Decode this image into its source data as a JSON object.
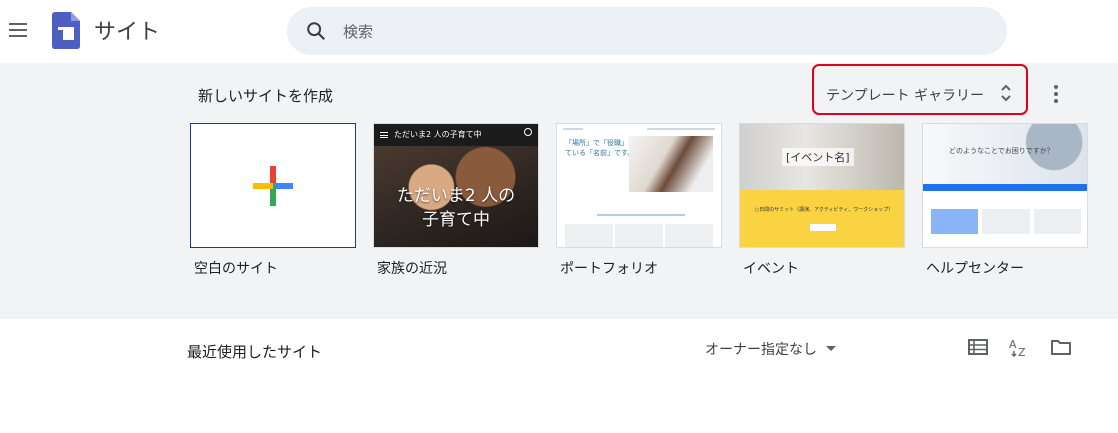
{
  "header": {
    "app_title": "サイト",
    "search_placeholder": "検索",
    "brand_color": "#4285f4"
  },
  "templates": {
    "section_title": "新しいサイトを作成",
    "gallery_label": "テンプレート ギャラリー",
    "items": [
      {
        "label": "空白のサイト"
      },
      {
        "label": "家族の近況",
        "preview_header": "ただいま2 人の子育て中",
        "preview_text_1": "ただいま2 人の",
        "preview_text_2": "子育て中"
      },
      {
        "label": "ポートフォリオ",
        "preview_quote_1": "「場所」で「役職」をし",
        "preview_quote_2": "ている「名前」です。"
      },
      {
        "label": "イベント",
        "preview_title": "[イベント名]",
        "preview_desc": "○日間のサミット（講演、アクティビティ、ワークショップ）"
      },
      {
        "label": "ヘルプセンター",
        "preview_question": "どのようなことでお困りですか？"
      }
    ]
  },
  "recent": {
    "section_title": "最近使用したサイト",
    "owner_filter": "オーナー指定なし"
  },
  "colors": {
    "highlight_border": "#e0001b",
    "band_bg": "#f1f3f4",
    "search_bg": "#edf1f6"
  }
}
